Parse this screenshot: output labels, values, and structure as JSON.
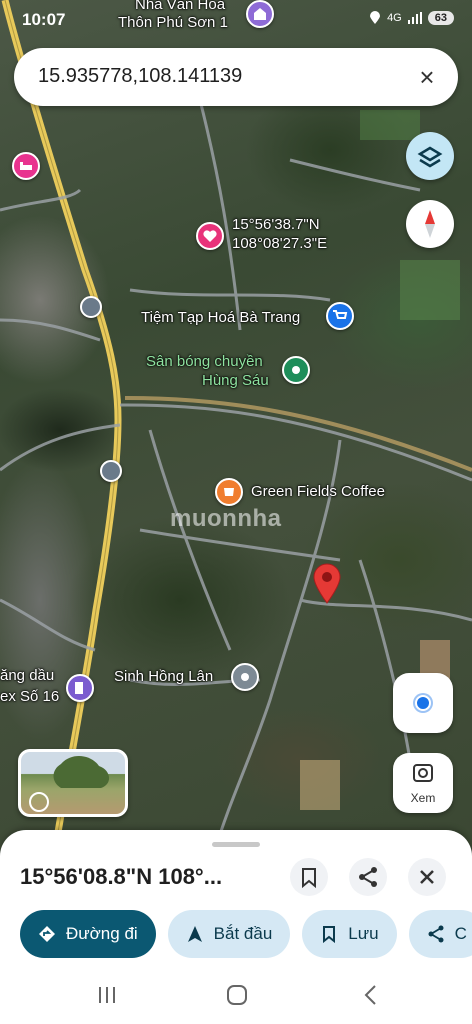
{
  "status": {
    "time": "10:07",
    "network": "4G",
    "battery": "63"
  },
  "search": {
    "query": "15.935778,108.141139",
    "close_label": "×"
  },
  "map": {
    "labels": {
      "top_cultural_center": "Nhà Văn Hoá",
      "top_cultural_center2": "Thôn Phú Sơn 1",
      "pin_coords_line1": "15°56'38.7\"N",
      "pin_coords_line2": "108°08'27.3\"E",
      "grocery": "Tiệm Tạp Hoá Bà Trang",
      "volleyball_line1": "Sân bóng chuyền",
      "volleyball_line2": "Hùng Sáu",
      "coffee": "Green Fields Coffee",
      "gas_line1": "ăng dầu",
      "gas_line2": "ex Số 16",
      "sinh_hong_lan": "Sinh Hồng Lân",
      "watermark": "muonnha"
    },
    "xem_label": "Xem"
  },
  "sheet": {
    "coords": "15°56'08.8\"N 108°...",
    "chips": {
      "directions": "Đường đi",
      "start": "Bắt đầu",
      "save": "Lưu",
      "share": "C"
    }
  },
  "colors": {
    "accent": "#0b5872",
    "chip": "#d5e8f4",
    "pin_red": "#e53935",
    "hotel_pink": "#e8338f"
  }
}
